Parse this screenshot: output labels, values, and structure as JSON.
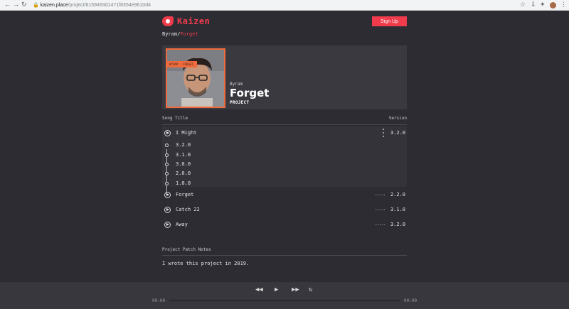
{
  "browser": {
    "url_host": "kaizen.place",
    "url_path": "/project/6159493d1471f8354e9610d4"
  },
  "brand": {
    "name": "Kaizen"
  },
  "header": {
    "signup_label": "Sign Up"
  },
  "breadcrumb": {
    "owner": "Byram",
    "separator": "/",
    "project": "Forget"
  },
  "project": {
    "owner": "Byram",
    "title": "Forget",
    "kind": "PROJECT",
    "cover_tag": "BYRAM · FORGET"
  },
  "table": {
    "col_song": "Song Title",
    "col_version": "Version"
  },
  "songs": [
    {
      "name": "I Might",
      "version": "3.2.0"
    },
    {
      "name": "Forget",
      "version": "2.2.0"
    },
    {
      "name": "Catch 22",
      "version": "3.1.0"
    },
    {
      "name": "Away",
      "version": "3.2.0"
    }
  ],
  "versions": [
    "3.2.0",
    "3.1.0",
    "3.0.0",
    "2.0.0",
    "1.0.0"
  ],
  "notes": {
    "heading": "Project Patch Notes",
    "body": "I wrote this project in 2019."
  },
  "player": {
    "time_current": "00:00",
    "time_total": "00:00"
  },
  "colors": {
    "accent": "#ef3b4c",
    "cover_accent": "#ef6a3c",
    "bg": "#2d2c32"
  }
}
